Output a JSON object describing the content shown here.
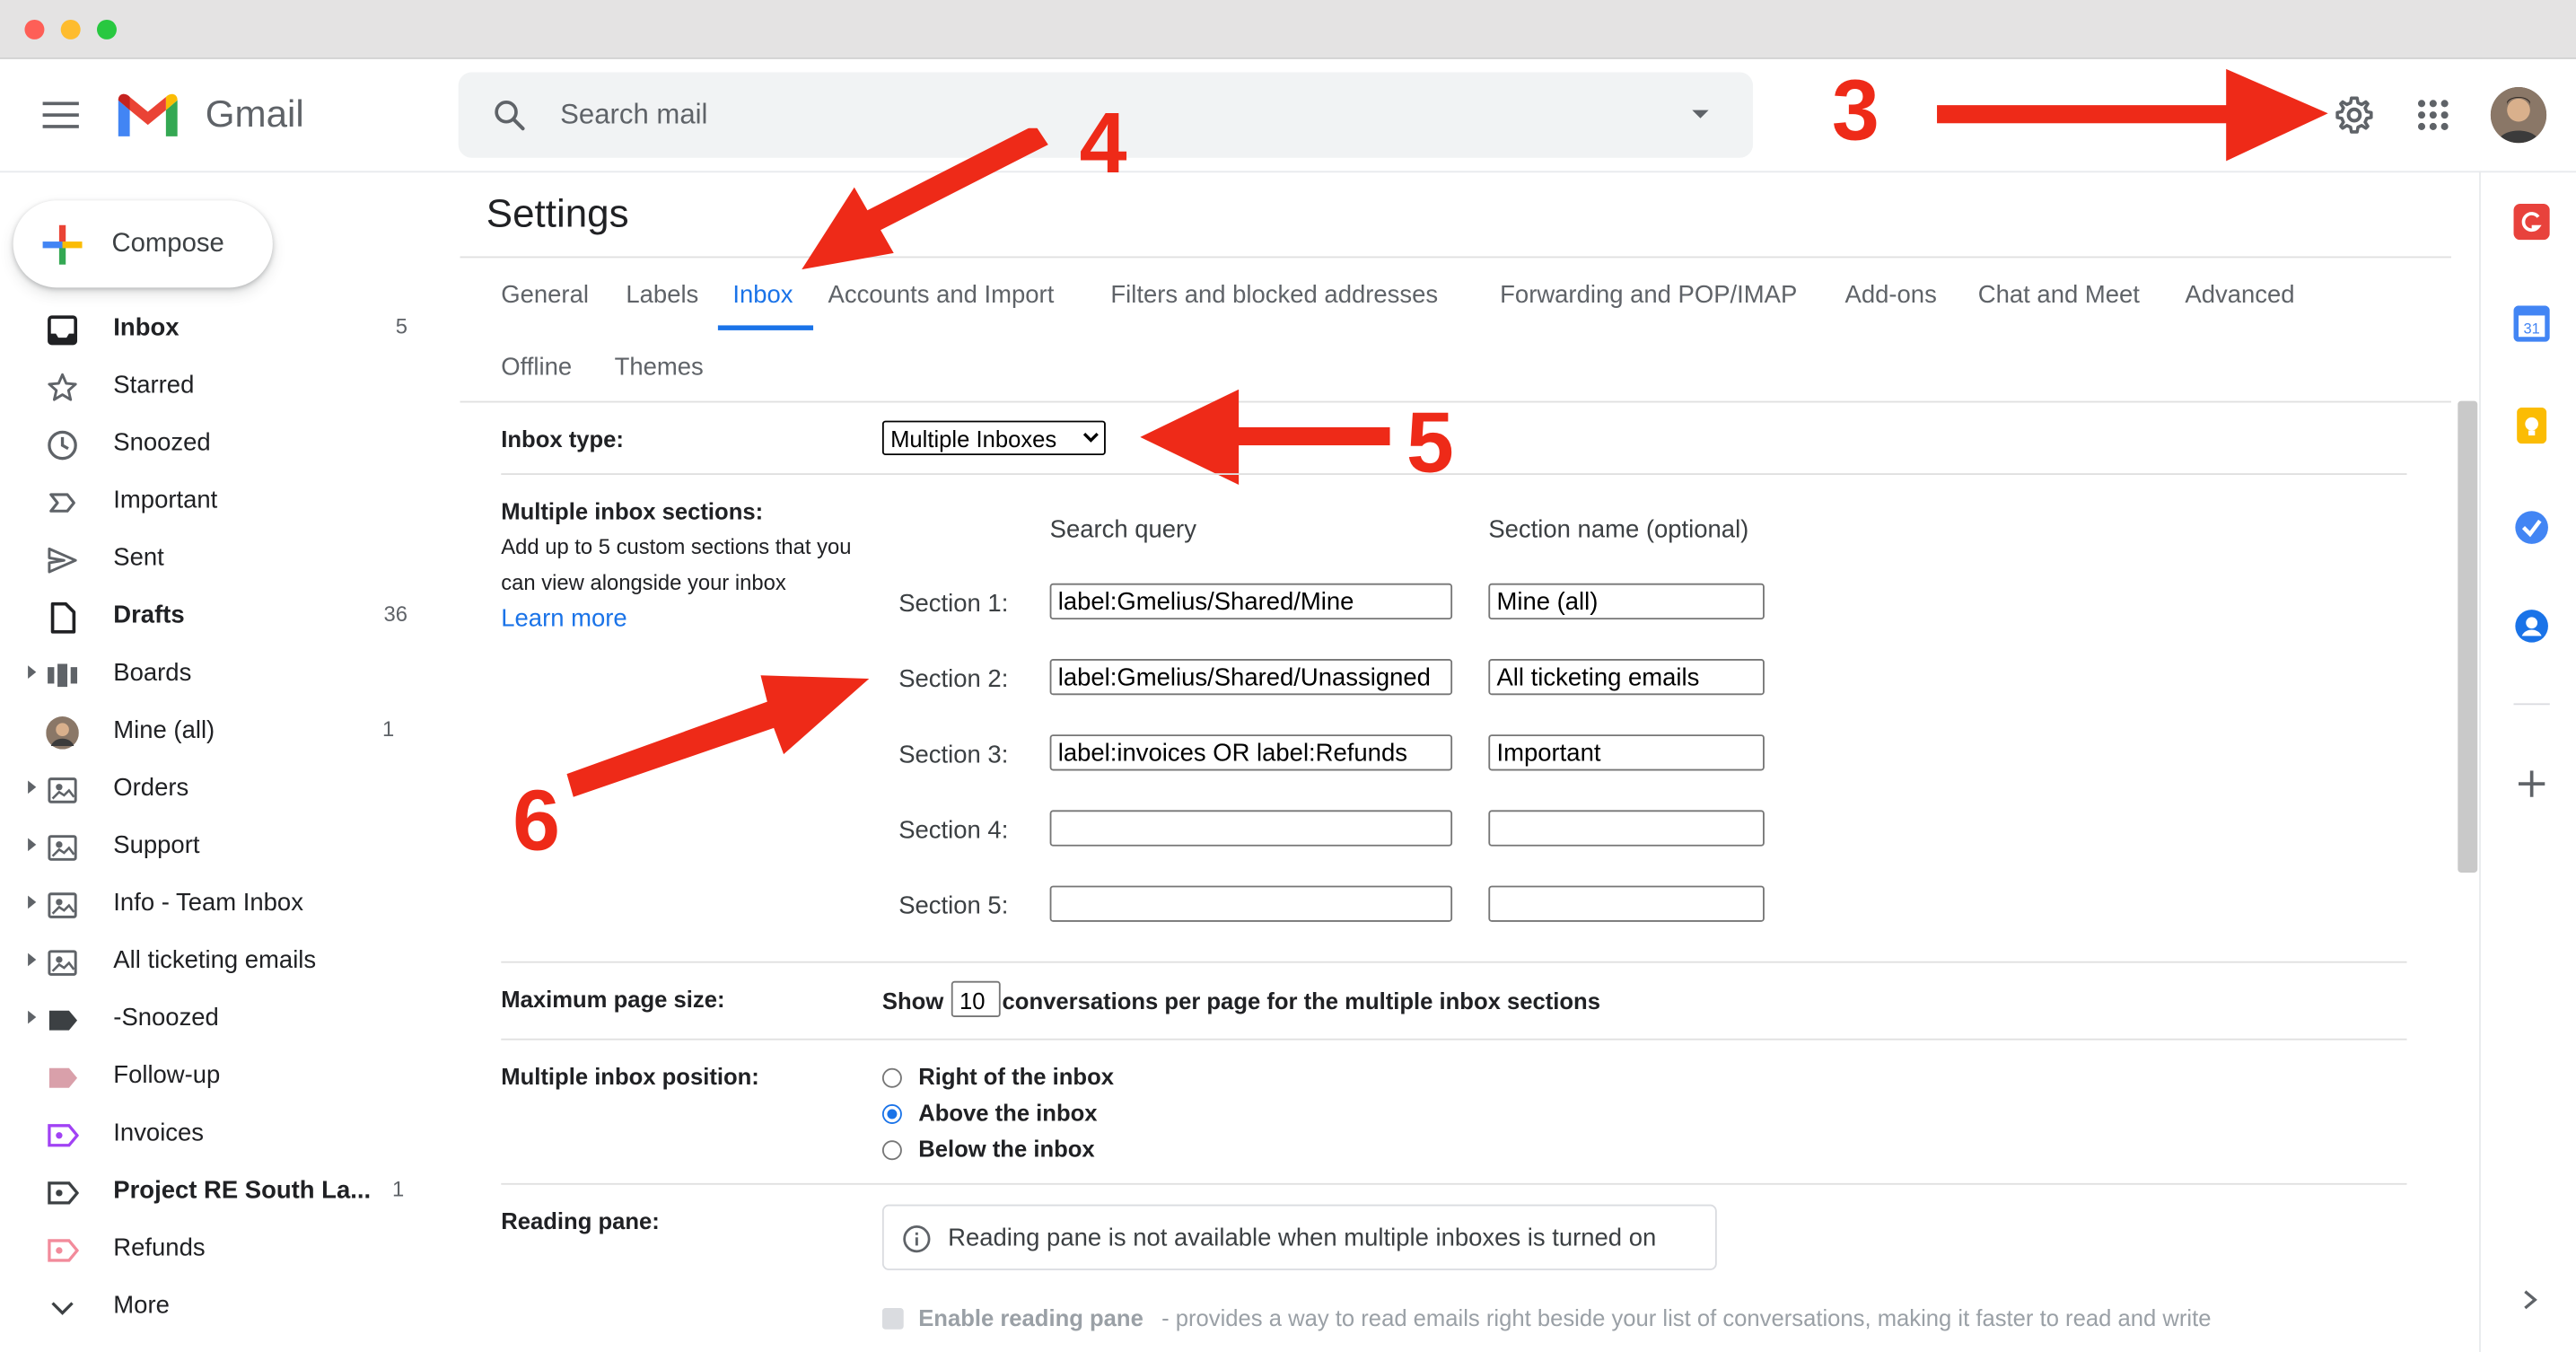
{
  "header": {
    "app_name": "Gmail",
    "search_placeholder": "Search mail"
  },
  "sidebar": {
    "compose_label": "Compose",
    "items": [
      {
        "label": "Inbox",
        "count": "5",
        "bold": true,
        "icon": "inbox-icon"
      },
      {
        "label": "Starred",
        "count": "",
        "icon": "star-icon"
      },
      {
        "label": "Snoozed",
        "count": "",
        "icon": "clock-icon"
      },
      {
        "label": "Important",
        "count": "",
        "icon": "important-icon"
      },
      {
        "label": "Sent",
        "count": "",
        "icon": "send-icon"
      },
      {
        "label": "Drafts",
        "count": "36",
        "bold": true,
        "icon": "draft-icon"
      },
      {
        "label": "Boards",
        "count": "",
        "icon": "boards-icon"
      },
      {
        "label": "Mine (all)",
        "count": "1",
        "icon": "avatar-icon"
      },
      {
        "label": "Orders",
        "count": "",
        "icon": "shared-label-icon"
      },
      {
        "label": "Support",
        "count": "",
        "icon": "shared-label-icon"
      },
      {
        "label": "Info - Team Inbox",
        "count": "",
        "icon": "shared-label-icon"
      },
      {
        "label": "All ticketing emails",
        "count": "",
        "icon": "shared-label-icon"
      },
      {
        "label": "-Snoozed",
        "count": "",
        "icon": "label-icon"
      },
      {
        "label": "Follow-up",
        "count": "",
        "icon": "label-icon"
      },
      {
        "label": "Invoices",
        "count": "",
        "icon": "shared-label-icon"
      },
      {
        "label": "Project RE South La...",
        "count": "1",
        "bold": true,
        "icon": "shared-label-icon"
      },
      {
        "label": "Refunds",
        "count": "",
        "icon": "shared-label-icon"
      },
      {
        "label": "More",
        "count": "",
        "icon": "chevron-down-icon"
      }
    ]
  },
  "settings": {
    "title": "Settings",
    "tabs": [
      "General",
      "Labels",
      "Inbox",
      "Accounts and Import",
      "Filters and blocked addresses",
      "Forwarding and POP/IMAP",
      "Add-ons",
      "Chat and Meet",
      "Advanced",
      "Offline",
      "Themes"
    ],
    "active_tab": "Inbox",
    "inbox_type_label": "Inbox type:",
    "inbox_type_value": "Multiple Inboxes",
    "sections_label": "Multiple inbox sections:",
    "sections_desc_1": "Add up to 5 custom sections that you",
    "sections_desc_2": "can view alongside your inbox",
    "learn_more": "Learn more",
    "col_query": "Search query",
    "col_name": "Section name (optional)",
    "sections": [
      {
        "label": "Section 1:",
        "query": "label:Gmelius/Shared/Mine",
        "name": "Mine (all)"
      },
      {
        "label": "Section 2:",
        "query": "label:Gmelius/Shared/Unassigned",
        "name": "All ticketing emails"
      },
      {
        "label": "Section 3:",
        "query": "label:invoices OR label:Refunds",
        "name": "Important"
      },
      {
        "label": "Section 4:",
        "query": "",
        "name": ""
      },
      {
        "label": "Section 5:",
        "query": "",
        "name": ""
      }
    ],
    "max_page_label": "Maximum page size:",
    "show_label": "Show",
    "page_size": "10",
    "page_size_suffix": "conversations per page for the multiple inbox sections",
    "position_label": "Multiple inbox position:",
    "positions": [
      "Right of the inbox",
      "Above the inbox",
      "Below the inbox"
    ],
    "selected_position": "Above the inbox",
    "reading_pane_label": "Reading pane:",
    "reading_pane_notice": "Reading pane is not available when multiple inboxes is turned on",
    "enable_reading_pane": "Enable reading pane",
    "enable_reading_pane_desc": "- provides a way to read emails right beside your list of conversations, making it faster to read and write"
  },
  "annotations": [
    "3",
    "4",
    "5",
    "6"
  ],
  "colors": {
    "accent": "#1a73e8",
    "annotation_red": "#ee2a18"
  }
}
